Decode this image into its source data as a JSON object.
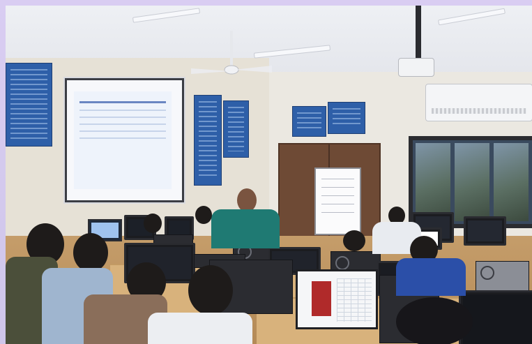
{
  "scene": {
    "description_tags": [
      "classroom",
      "computer-lab",
      "projector",
      "students",
      "instructor"
    ]
  },
  "colors": {
    "poster_blue": "#2e5fa8",
    "door_brown": "#6e4a35",
    "instructor_shirt": "#1f7a73",
    "desk_wood": "#d8b27c",
    "frame_lilac": "#d9cdf2"
  }
}
